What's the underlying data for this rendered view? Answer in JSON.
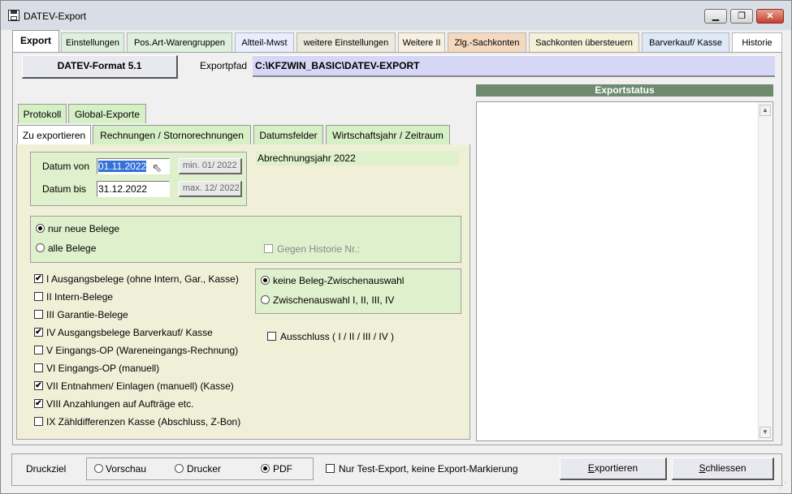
{
  "window": {
    "title": "DATEV-Export",
    "minimize": "▁",
    "maximize": "❐",
    "close": "✕"
  },
  "main_tabs": [
    {
      "label": "Export",
      "color": "#ffffff"
    },
    {
      "label": "Einstellungen",
      "color": "#ddf0dd"
    },
    {
      "label": "Pos.Art-Warengruppen",
      "color": "#ddf0dd"
    },
    {
      "label": "Altteil-Mwst",
      "color": "#e8eeff"
    },
    {
      "label": "weitere Einstellungen",
      "color": "#eceadc"
    },
    {
      "label": "Weitere II",
      "color": "#f8f0e0"
    },
    {
      "label": "Zlg.-Sachkonten",
      "color": "#f5d8c0"
    },
    {
      "label": "Sachkonten übersteuern",
      "color": "#f5f0d8"
    },
    {
      "label": "Barverkauf/ Kasse",
      "color": "#dde8f8"
    },
    {
      "label": "Historie",
      "color": "#ffffff"
    }
  ],
  "format_button": "DATEV-Format 5.1",
  "exportpfad": {
    "label": "Exportpfad",
    "value": "C:\\KFZWIN_BASIC\\DATEV-EXPORT"
  },
  "status": {
    "header": "Exportstatus"
  },
  "sub_tabs_top": [
    {
      "label": "Protokoll"
    },
    {
      "label": "Global-Exporte"
    }
  ],
  "sub_tabs": [
    {
      "label": "Zu exportieren"
    },
    {
      "label": "Rechnungen / Stornorechnungen"
    },
    {
      "label": "Datumsfelder"
    },
    {
      "label": "Wirtschaftsjahr / Zeitraum"
    }
  ],
  "date": {
    "from_label": "Datum von",
    "from_value": "01.11.2022",
    "min_hint": "min. 01/ 2022",
    "to_label": "Datum bis",
    "to_value": "31.12.2022",
    "max_hint": "max. 12/ 2022"
  },
  "abrechnungsjahr": "Abrechnungsjahr 2022",
  "belege": {
    "option1": "nur neue Belege",
    "option2": "alle Belege",
    "historie": "Gegen Historie Nr.:"
  },
  "checkboxes": [
    {
      "label": "I Ausgangsbelege (ohne Intern, Gar., Kasse)",
      "checked": "✔"
    },
    {
      "label": "II Intern-Belege",
      "checked": ""
    },
    {
      "label": "III Garantie-Belege",
      "checked": ""
    },
    {
      "label": "IV Ausgangsbelege Barverkauf/ Kasse",
      "checked": "✔"
    },
    {
      "label": "V Eingangs-OP (Wareneingangs-Rechnung)",
      "checked": ""
    },
    {
      "label": "VI Eingangs-OP (manuell)",
      "checked": ""
    },
    {
      "label": "VII Entnahmen/ Einlagen (manuell) (Kasse)",
      "checked": "✔"
    },
    {
      "label": "VIII Anzahlungen auf Aufträge etc.",
      "checked": "✔"
    },
    {
      "label": "IX Zähldifferenzen Kasse (Abschluss, Z-Bon)",
      "checked": ""
    }
  ],
  "zwischenauswahl": {
    "option1": "keine Beleg-Zwischenauswahl",
    "option2": "Zwischenauswahl I, II, III, IV"
  },
  "ausschluss": "Ausschluss ( I / II / III / IV )",
  "footer": {
    "druckziel_label": "Druckziel",
    "options": [
      "Vorschau",
      "Drucker",
      "PDF"
    ],
    "test_export": "Nur Test-Export, keine Export-Markierung",
    "export_btn_first": "E",
    "export_btn_rest": "xportieren",
    "close_btn_first": "S",
    "close_btn_rest": "chliessen"
  }
}
